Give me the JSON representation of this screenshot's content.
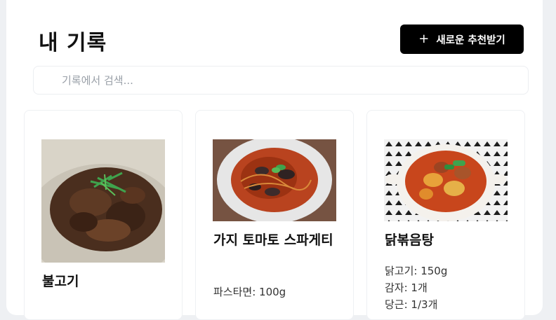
{
  "header": {
    "title": "내 기록",
    "new_button": {
      "icon": "plus-icon",
      "label": "새로운 추천받기"
    }
  },
  "search": {
    "placeholder": "기록에서 검색..."
  },
  "cards": [
    {
      "name": "불고기",
      "ingredients": []
    },
    {
      "name": "가지 토마토 스파게티",
      "ingredients": [
        "파스타면: 100g"
      ]
    },
    {
      "name": "닭볶음탕",
      "ingredients": [
        "닭고기: 150g",
        "감자: 1개",
        "당근: 1/3개"
      ]
    }
  ]
}
